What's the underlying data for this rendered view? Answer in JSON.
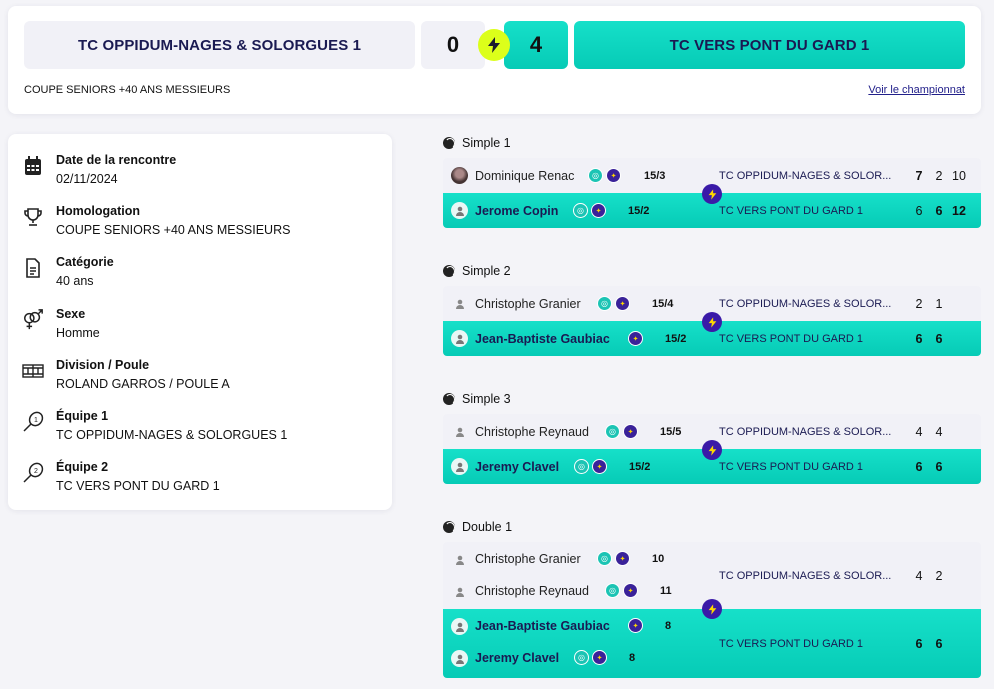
{
  "header": {
    "home_team": "TC OPPIDUM-NAGES & SOLORGUES 1",
    "away_team": "TC VERS PONT DU GARD 1",
    "home_score": "0",
    "away_score": "4",
    "competition": "COUPE SENIORS +40 ANS MESSIEURS",
    "championship_link": "Voir le championnat"
  },
  "info": [
    {
      "title": "Date de la rencontre",
      "value": "02/11/2024",
      "icon": "calendar-icon"
    },
    {
      "title": "Homologation",
      "value": "COUPE SENIORS +40 ANS MESSIEURS",
      "icon": "trophy-icon"
    },
    {
      "title": "Catégorie",
      "value": "40 ans",
      "icon": "document-icon"
    },
    {
      "title": "Sexe",
      "value": "Homme",
      "icon": "gender-icon"
    },
    {
      "title": "Division / Poule",
      "value": "ROLAND GARROS / POULE A",
      "icon": "court-icon"
    },
    {
      "title": "Équipe 1",
      "value": "TC OPPIDUM-NAGES & SOLORGUES 1",
      "icon": "racket-1-icon"
    },
    {
      "title": "Équipe 2",
      "value": "TC VERS PONT DU GARD 1",
      "icon": "racket-2-icon"
    }
  ],
  "matches": [
    {
      "title": "Simple 1",
      "home": {
        "players": [
          {
            "name": "Dominique Renac",
            "rank": "15/3"
          }
        ],
        "team": "TC OPPIDUM-NAGES & SOLOR...",
        "sets": [
          "7",
          "2",
          "10"
        ]
      },
      "away": {
        "players": [
          {
            "name": "Jerome Copin",
            "rank": "15/2"
          }
        ],
        "team": "TC VERS PONT DU GARD 1",
        "sets": [
          "6",
          "6",
          "12"
        ]
      }
    },
    {
      "title": "Simple 2",
      "home": {
        "players": [
          {
            "name": "Christophe Granier",
            "rank": "15/4"
          }
        ],
        "team": "TC OPPIDUM-NAGES & SOLOR...",
        "sets": [
          "2",
          "1"
        ]
      },
      "away": {
        "players": [
          {
            "name": "Jean-Baptiste Gaubiac",
            "rank": "15/2"
          }
        ],
        "team": "TC VERS PONT DU GARD 1",
        "sets": [
          "6",
          "6"
        ]
      }
    },
    {
      "title": "Simple 3",
      "home": {
        "players": [
          {
            "name": "Christophe Reynaud",
            "rank": "15/5"
          }
        ],
        "team": "TC OPPIDUM-NAGES & SOLOR...",
        "sets": [
          "4",
          "4"
        ]
      },
      "away": {
        "players": [
          {
            "name": "Jeremy Clavel",
            "rank": "15/2"
          }
        ],
        "team": "TC VERS PONT DU GARD 1",
        "sets": [
          "6",
          "6"
        ]
      }
    },
    {
      "title": "Double 1",
      "home": {
        "players": [
          {
            "name": "Christophe Granier",
            "rank": "10"
          },
          {
            "name": "Christophe Reynaud",
            "rank": "11"
          }
        ],
        "team": "TC OPPIDUM-NAGES & SOLOR...",
        "sets": [
          "4",
          "2"
        ]
      },
      "away": {
        "players": [
          {
            "name": "Jean-Baptiste Gaubiac",
            "rank": "8"
          },
          {
            "name": "Jeremy Clavel",
            "rank": "8"
          }
        ],
        "team": "TC VERS PONT DU GARD 1",
        "sets": [
          "6",
          "6"
        ]
      }
    }
  ],
  "colors": {
    "accent_teal": "#0fd6c0",
    "accent_purple": "#3a1aa8",
    "bolt_yellow": "#dcff1a",
    "navy": "#1a1a52"
  }
}
